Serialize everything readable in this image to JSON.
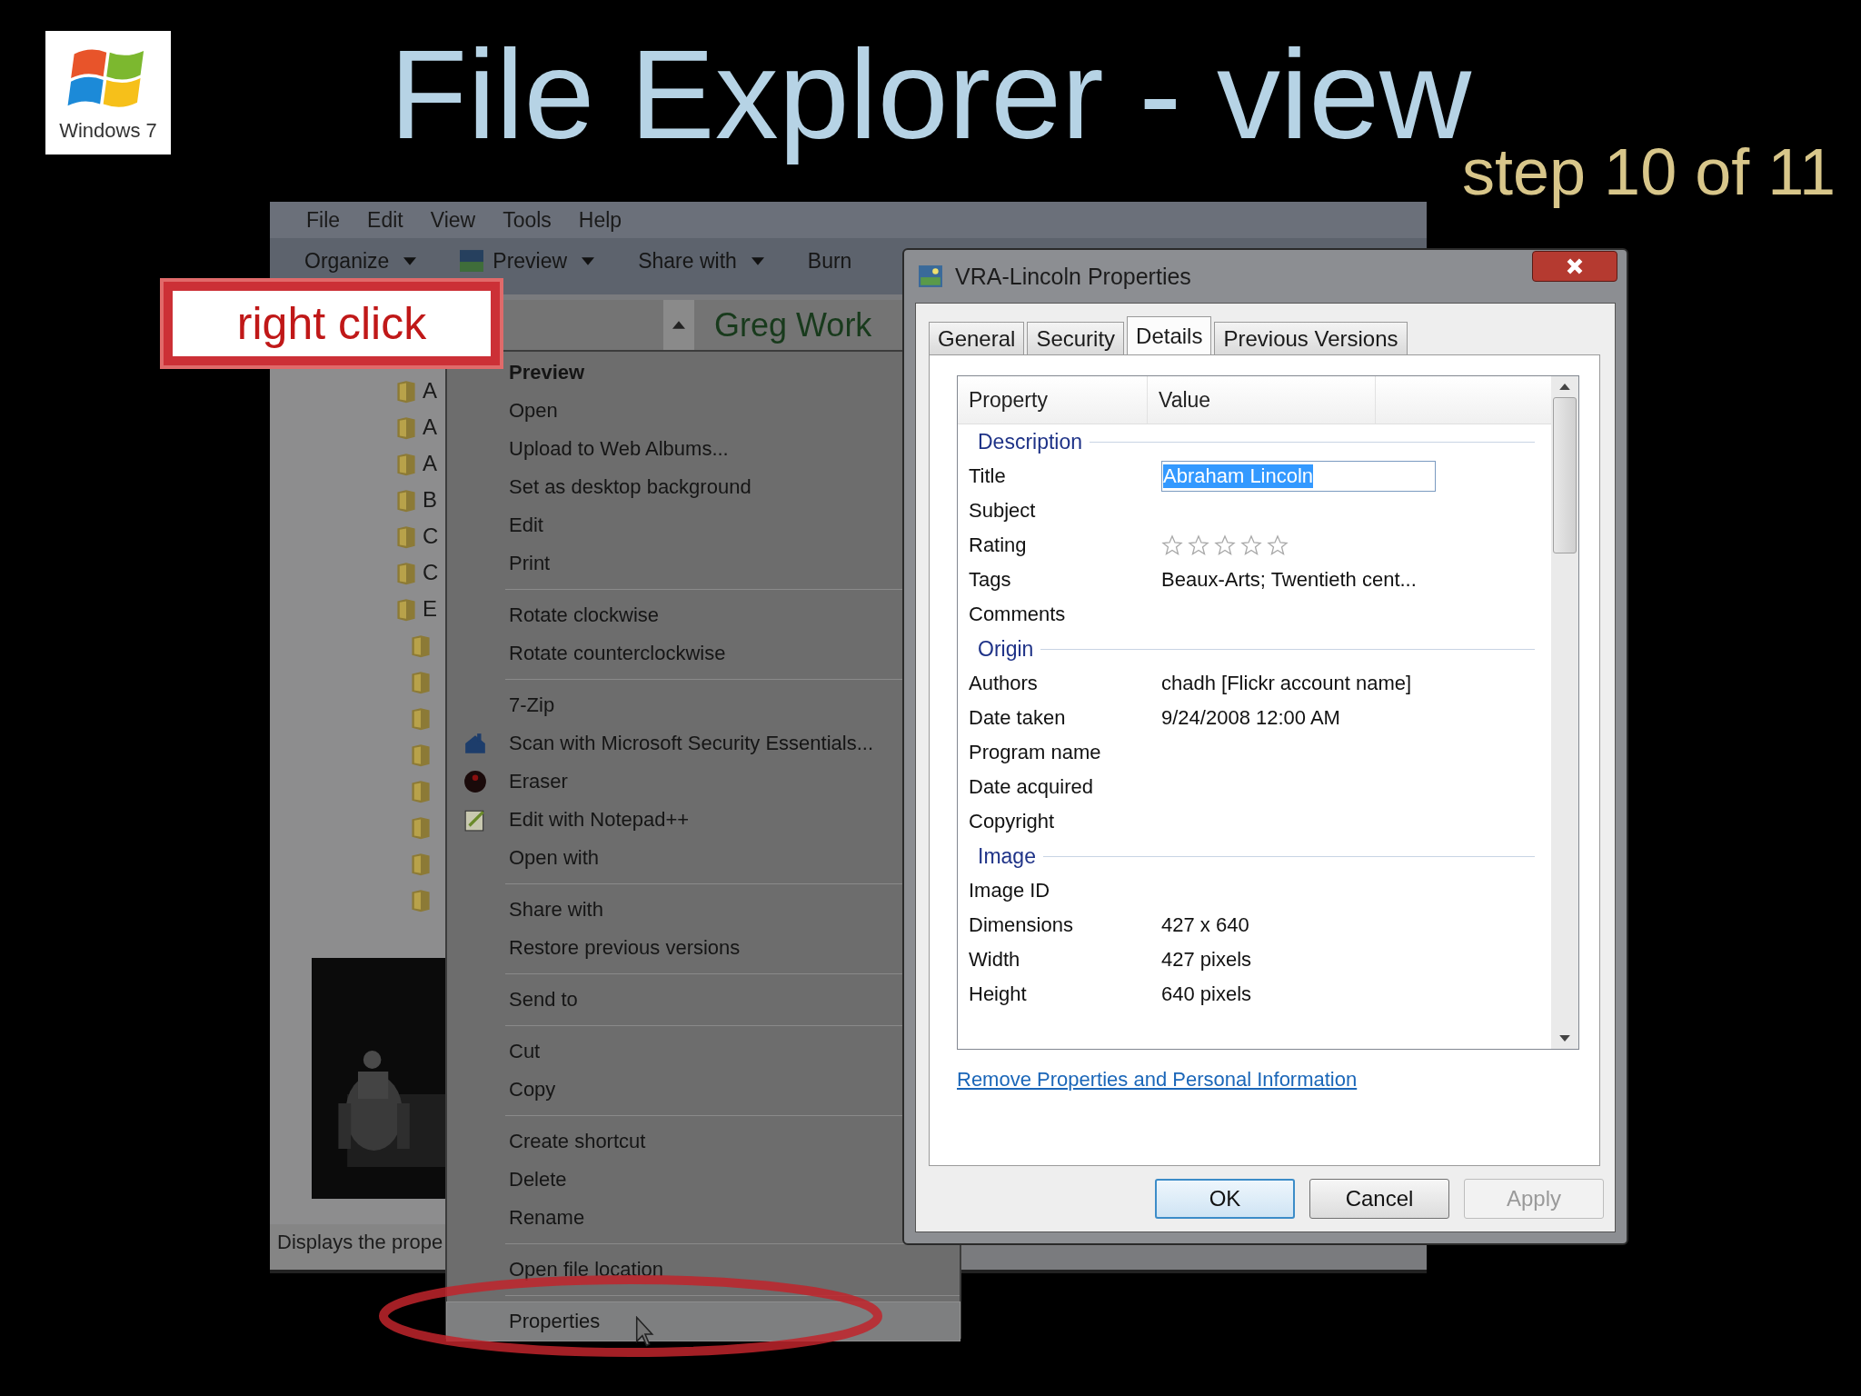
{
  "slide": {
    "logo_text": "Windows 7",
    "title": "File Explorer - view",
    "step": "step 10 of 11",
    "callout": "right click"
  },
  "explorer": {
    "menu": [
      "File",
      "Edit",
      "View",
      "Tools",
      "Help"
    ],
    "toolbar": [
      {
        "label": "Organize",
        "dropdown": true
      },
      {
        "label": "Preview",
        "dropdown": true
      },
      {
        "label": "Share with",
        "dropdown": true
      },
      {
        "label": "Burn",
        "dropdown": false
      }
    ],
    "folder_title": "Greg Work",
    "folders": [
      {
        "label": "A"
      },
      {
        "label": "A"
      },
      {
        "label": "A"
      },
      {
        "label": "B"
      },
      {
        "label": "C"
      },
      {
        "label": "C"
      },
      {
        "label": "E"
      }
    ],
    "status_bar": "Displays the prope"
  },
  "context_menu": {
    "groups": [
      {
        "items": [
          {
            "label": "Preview",
            "default": true,
            "selected": false
          },
          {
            "label": "Open",
            "default": false,
            "selected": false
          },
          {
            "label": "Upload to Web Albums...",
            "default": false,
            "selected": false
          },
          {
            "label": "Set as desktop background",
            "default": false,
            "selected": false
          },
          {
            "label": "Edit",
            "default": false,
            "selected": false
          },
          {
            "label": "Print",
            "default": false,
            "selected": false
          }
        ]
      },
      {
        "items": [
          {
            "label": "Rotate clockwise",
            "default": false,
            "selected": false
          },
          {
            "label": "Rotate counterclockwise",
            "default": false,
            "selected": false
          }
        ]
      },
      {
        "items": [
          {
            "label": "7-Zip",
            "default": false,
            "selected": false
          },
          {
            "label": "Scan with Microsoft Security Essentials...",
            "default": false,
            "selected": false
          },
          {
            "label": "Eraser",
            "default": false,
            "selected": false
          },
          {
            "label": "Edit with Notepad++",
            "default": false,
            "selected": false
          },
          {
            "label": "Open with",
            "default": false,
            "selected": false
          }
        ]
      },
      {
        "items": [
          {
            "label": "Share with",
            "default": false,
            "selected": false
          },
          {
            "label": "Restore previous versions",
            "default": false,
            "selected": false
          }
        ]
      },
      {
        "items": [
          {
            "label": "Send to",
            "default": false,
            "selected": false
          }
        ]
      },
      {
        "items": [
          {
            "label": "Cut",
            "default": false,
            "selected": false
          },
          {
            "label": "Copy",
            "default": false,
            "selected": false
          }
        ]
      },
      {
        "items": [
          {
            "label": "Create shortcut",
            "default": false,
            "selected": false
          },
          {
            "label": "Delete",
            "default": false,
            "selected": false
          },
          {
            "label": "Rename",
            "default": false,
            "selected": false
          }
        ]
      },
      {
        "items": [
          {
            "label": "Open file location",
            "default": false,
            "selected": false
          }
        ]
      },
      {
        "items": [
          {
            "label": "Properties",
            "default": false,
            "selected": true
          }
        ]
      }
    ]
  },
  "dialog": {
    "title": "VRA-Lincoln Properties",
    "tabs": [
      {
        "label": "General",
        "selected": false
      },
      {
        "label": "Security",
        "selected": false
      },
      {
        "label": "Details",
        "selected": true
      },
      {
        "label": "Previous Versions",
        "selected": false
      }
    ],
    "columns": [
      "Property",
      "Value"
    ],
    "sections": [
      {
        "heading": "Description",
        "rows": [
          {
            "kind": "field",
            "property": "Title",
            "value": "Abraham Lincoln"
          },
          {
            "kind": "text",
            "property": "Subject"
          },
          {
            "kind": "stars",
            "property": "Rating",
            "stars": 0
          },
          {
            "kind": "text",
            "property": "Tags",
            "value": "Beaux-Arts; Twentieth cent..."
          },
          {
            "kind": "text",
            "property": "Comments"
          }
        ]
      },
      {
        "heading": "Origin",
        "rows": [
          {
            "kind": "text",
            "property": "Authors",
            "value": "chadh [Flickr account name]"
          },
          {
            "kind": "text",
            "property": "Date taken",
            "value": "9/24/2008 12:00 AM"
          },
          {
            "kind": "text",
            "property": "Program name"
          },
          {
            "kind": "text",
            "property": "Date acquired"
          },
          {
            "kind": "text",
            "property": "Copyright"
          }
        ]
      },
      {
        "heading": "Image",
        "rows": [
          {
            "kind": "text",
            "property": "Image ID"
          },
          {
            "kind": "text",
            "property": "Dimensions",
            "value": "427 x 640"
          },
          {
            "kind": "text",
            "property": "Width",
            "value": "427 pixels"
          },
          {
            "kind": "text",
            "property": "Height",
            "value": "640 pixels"
          }
        ]
      }
    ],
    "link": "Remove Properties and Personal Information",
    "buttons": [
      {
        "label": "OK",
        "default": true,
        "disabled": false
      },
      {
        "label": "Cancel",
        "default": false,
        "disabled": false
      },
      {
        "label": "Apply",
        "default": false,
        "disabled": true
      }
    ]
  }
}
